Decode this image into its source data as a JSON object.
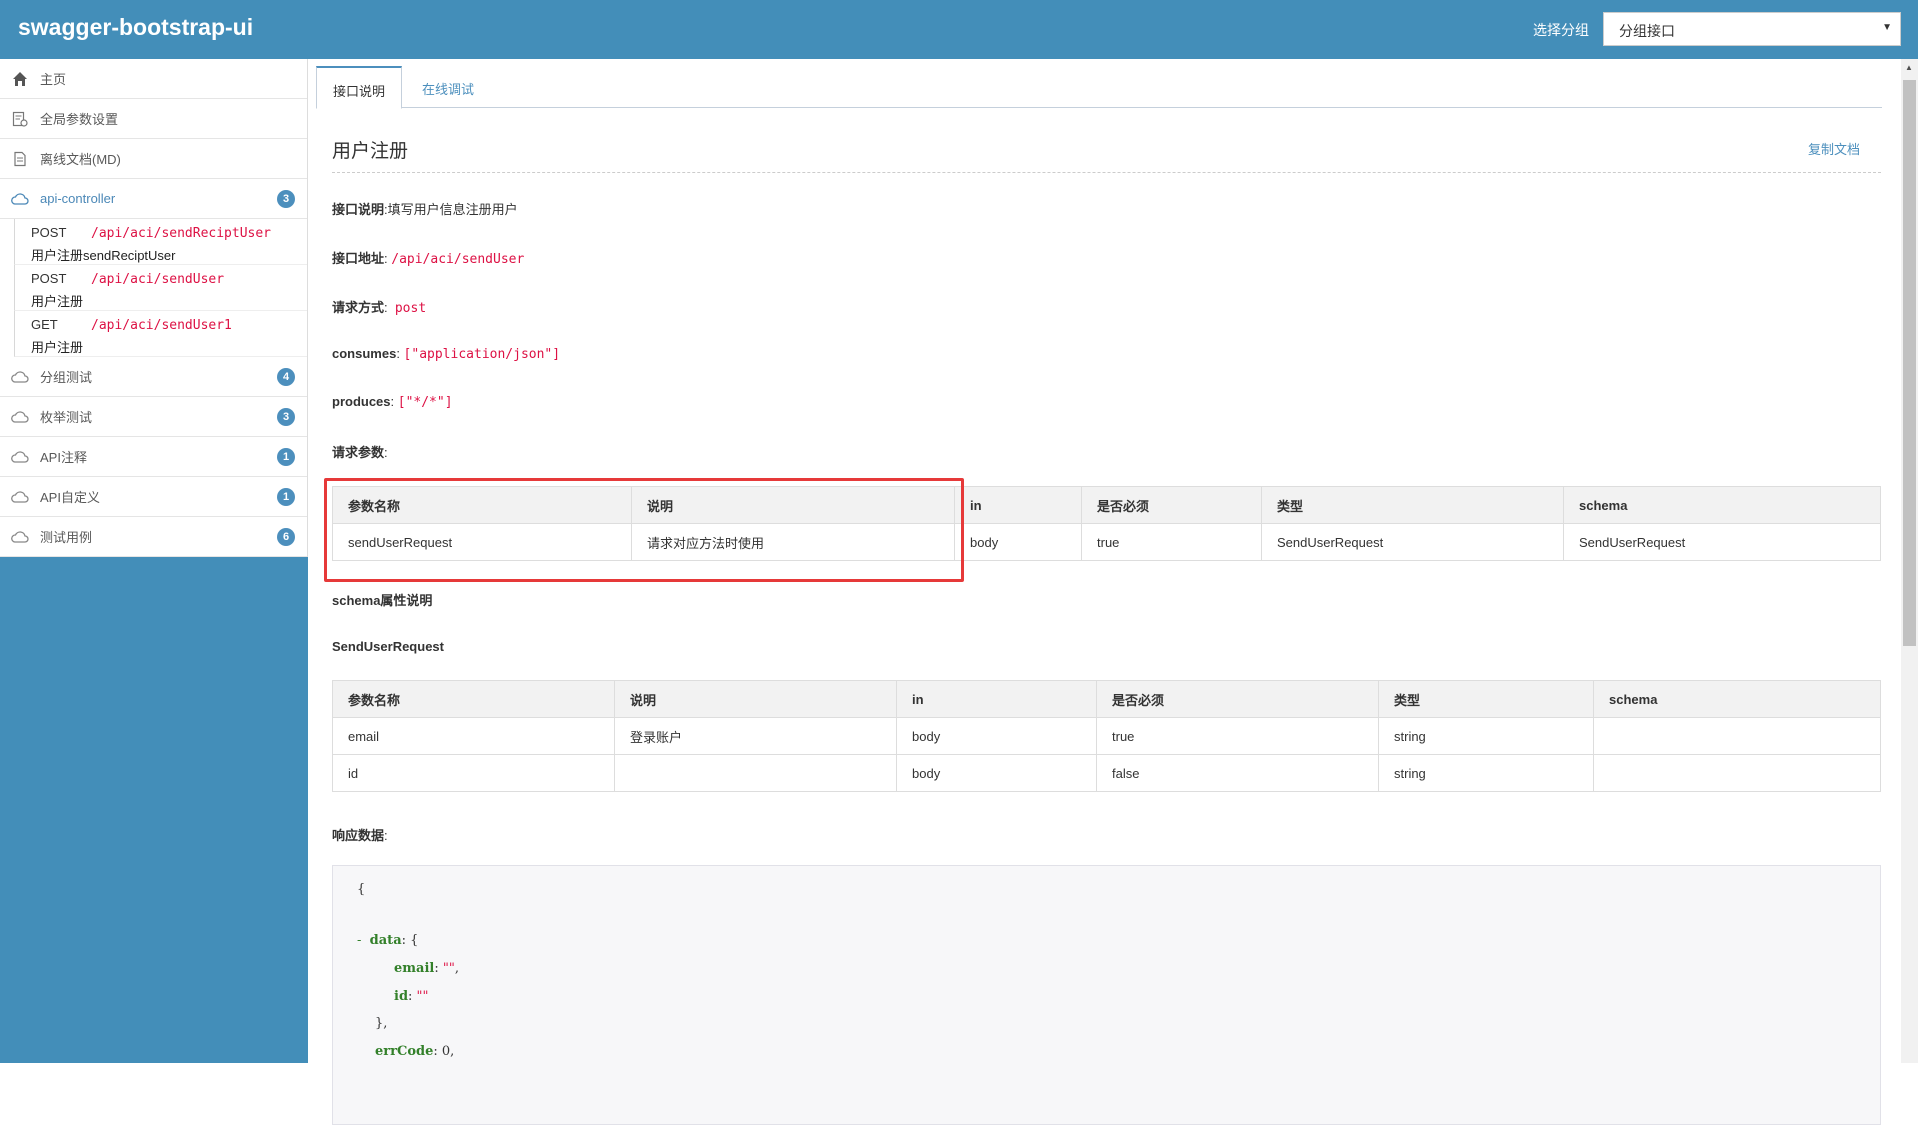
{
  "header": {
    "brand": "swagger-bootstrap-ui",
    "group_label": "选择分组",
    "group_value": "分组接口"
  },
  "sidebar": {
    "items": [
      {
        "label": "主页",
        "icon": "home-icon"
      },
      {
        "label": "全局参数设置",
        "icon": "settings-doc-icon"
      },
      {
        "label": "离线文档(MD)",
        "icon": "document-icon"
      },
      {
        "label": "api-controller",
        "icon": "cloud-icon",
        "badge": "3",
        "active": true
      }
    ],
    "endpoints": [
      {
        "method": "POST",
        "path": "/api/aci/sendReciptUser",
        "summary": "用户注册sendReciptUser"
      },
      {
        "method": "POST",
        "path": "/api/aci/sendUser",
        "summary": "用户注册"
      },
      {
        "method": "GET",
        "path": "/api/aci/sendUser1",
        "summary": "用户注册"
      }
    ],
    "groups": [
      {
        "label": "分组测试",
        "badge": "4"
      },
      {
        "label": "枚举测试",
        "badge": "3"
      },
      {
        "label": "API注释",
        "badge": "1"
      },
      {
        "label": "API自定义",
        "badge": "1"
      },
      {
        "label": "测试用例",
        "badge": "6"
      }
    ]
  },
  "tabs": {
    "doc": "接口说明",
    "debug": "在线调试"
  },
  "doc": {
    "title": "用户注册",
    "copy_link": "复制文档",
    "desc_label": "接口说明",
    "desc_value": ":填写用户信息注册用户",
    "url_label": "接口地址",
    "url_value": "/api/aci/sendUser",
    "method_label": "请求方式",
    "method_value": "post",
    "consumes_label": "consumes",
    "consumes_value": "[\"application/json\"]",
    "produces_label": "produces",
    "produces_value": "[\"*/*\"]",
    "req_params_label": "请求参数",
    "schema_desc_label": "schema属性说明",
    "schema_name": "SendUserRequest",
    "resp_label": "响应数据"
  },
  "req_table": {
    "headers": [
      "参数名称",
      "说明",
      "in",
      "是否必须",
      "类型",
      "schema"
    ],
    "rows": [
      [
        "sendUserRequest",
        "请求对应方法时使用",
        "body",
        "true",
        "SendUserRequest",
        "SendUserRequest"
      ]
    ]
  },
  "schema_table": {
    "headers": [
      "参数名称",
      "说明",
      "in",
      "是否必须",
      "类型",
      "schema"
    ],
    "rows": [
      [
        "email",
        "登录账户",
        "body",
        "true",
        "string",
        ""
      ],
      [
        "id",
        "",
        "body",
        "false",
        "string",
        ""
      ]
    ]
  },
  "response": {
    "open_brace": "{",
    "toggle": "-",
    "data_key": "data",
    "data_open": ": {",
    "email_key": "email",
    "email_val": "\"\"",
    "id_key": "id",
    "id_val": "\"\"",
    "data_close": "},",
    "errcode_key": "errCode",
    "errcode_val": ": 0,"
  },
  "colors": {
    "accent": "#438eb9",
    "highlight_border": "#e63939",
    "code_red": "#d14"
  }
}
